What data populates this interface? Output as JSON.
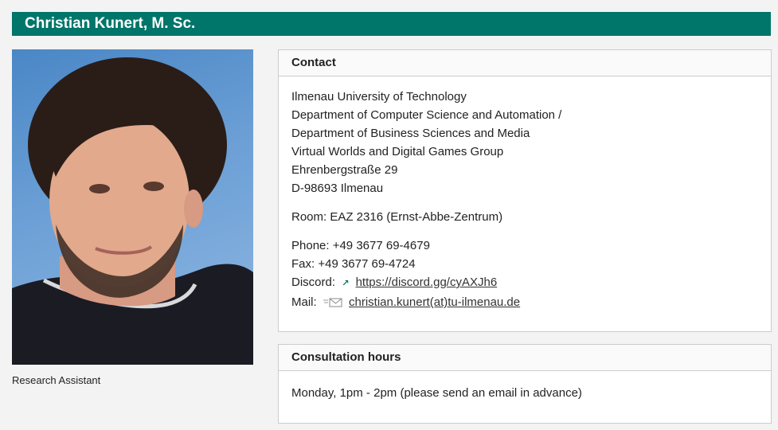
{
  "header": {
    "name": "Christian Kunert, M. Sc."
  },
  "profile": {
    "caption": "Research Assistant",
    "photo_icon": "portrait-photo"
  },
  "contact": {
    "heading": "Contact",
    "address": [
      "Ilmenau University of Technology",
      "Department of Computer Science and Automation /",
      "Department of Business Sciences and Media",
      "Virtual Worlds and Digital Games Group",
      "Ehrenbergstraße 29",
      "D-98693 Ilmenau"
    ],
    "room": "Room: EAZ 2316 (Ernst-Abbe-Zentrum)",
    "phone": "Phone: +49 3677 69-4679",
    "fax": "Fax: +49 3677 69-4724",
    "discord_label": "Discord:",
    "discord_link": "https://discord.gg/cyAXJh6",
    "mail_label": "Mail:",
    "mail_link": "christian.kunert(at)tu-ilmenau.de"
  },
  "consultation": {
    "heading": "Consultation hours",
    "text": "Monday, 1pm - 2pm (please send an email in advance)"
  },
  "colors": {
    "accent": "#00756a",
    "border": "#cccccc",
    "background": "#f3f3f3"
  }
}
